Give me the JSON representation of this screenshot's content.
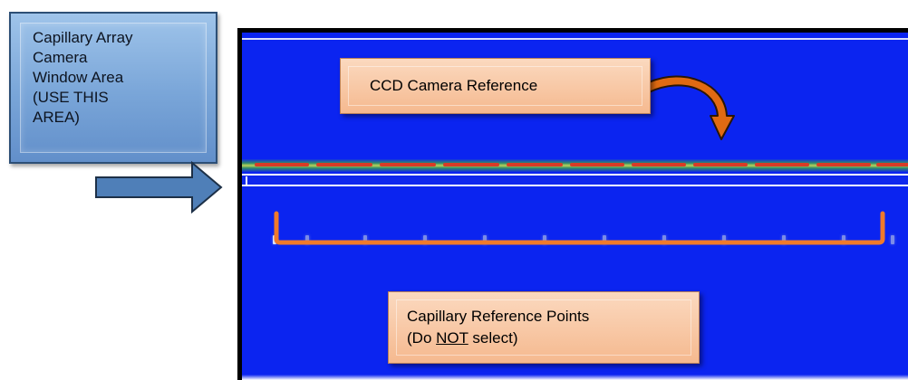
{
  "callout_left": {
    "text": "Capillary Array\nCamera\nWindow Area\n(USE THIS\nAREA)"
  },
  "ccd_label": {
    "text": "CCD Camera Reference"
  },
  "capillary_label": {
    "line1": "Capillary Reference Points",
    "line2_prefix": "(Do ",
    "line2_emphasis": "NOT",
    "line2_suffix": " select)"
  },
  "colors": {
    "window_blue": "#0b24f0",
    "callout_blue": "#79a5d8",
    "callout_orange": "#f5b98f",
    "arrow_orange": "#e06a12",
    "bracket_orange": "#f07a2a",
    "fluorescence_green": "#b9d45a",
    "fluorescence_red": "#d83b26"
  },
  "icons": {
    "left_arrow": "right-arrow-icon",
    "ccd_arrow": "curved-arrow-icon",
    "bracket": "bracket-icon"
  }
}
